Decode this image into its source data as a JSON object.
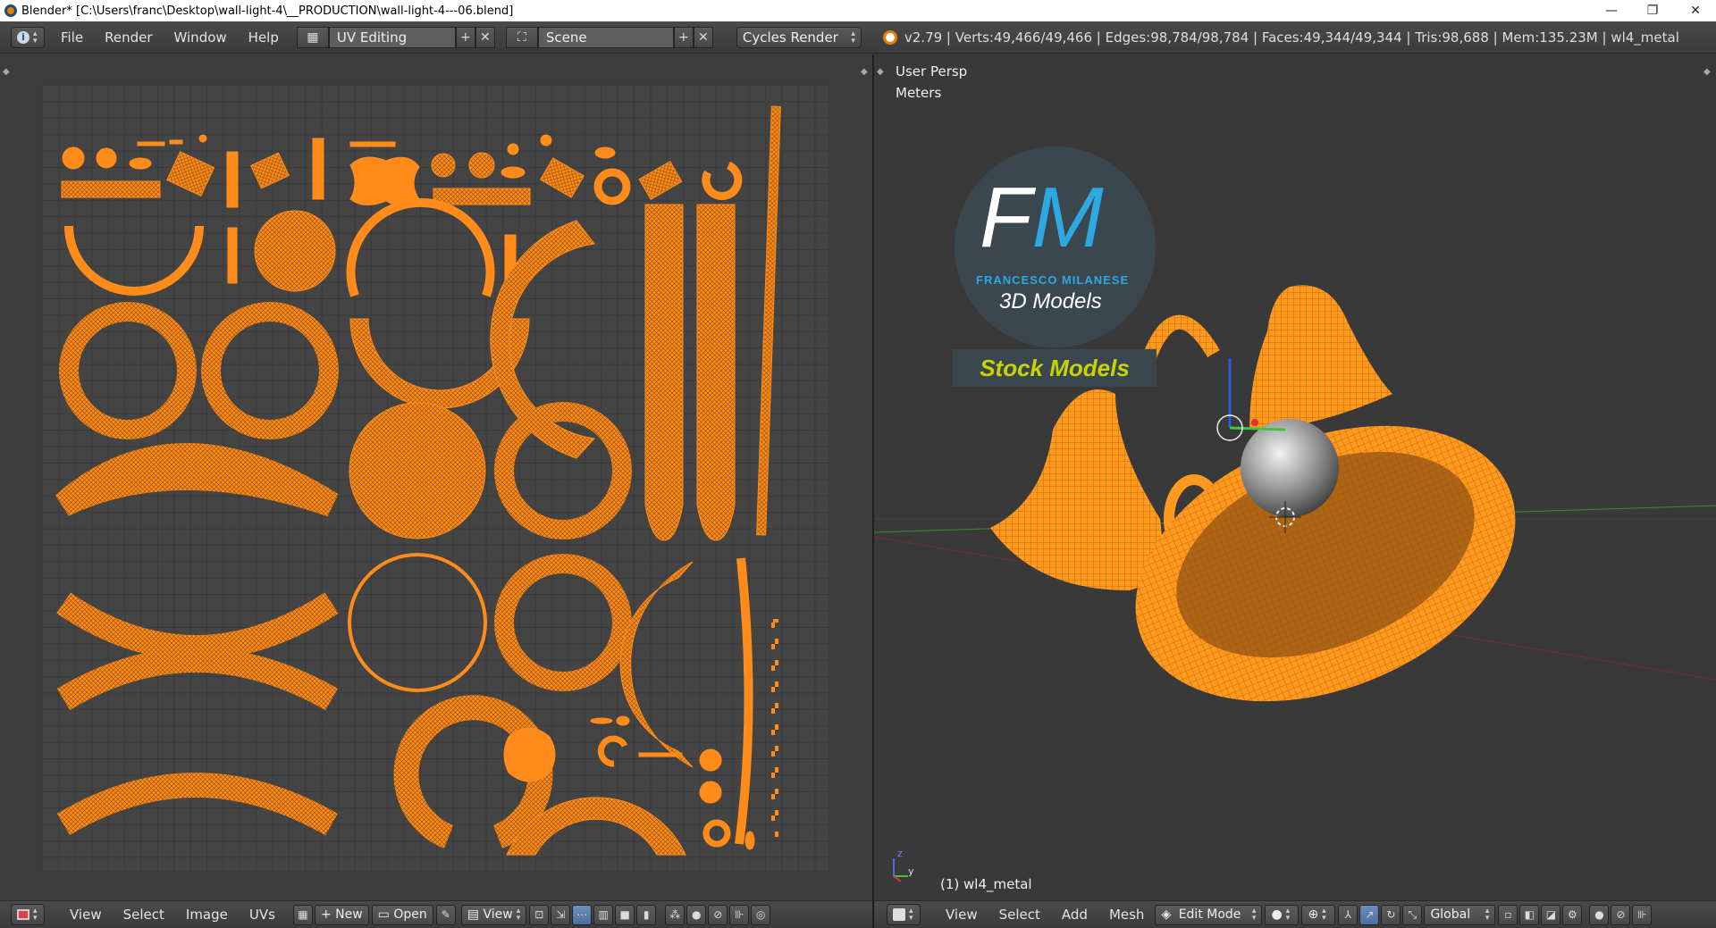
{
  "window": {
    "title": "Blender* [C:\\Users\\franc\\Desktop\\wall-light-4\\__PRODUCTION\\wall-light-4---06.blend]",
    "controls": [
      "—",
      "❐",
      "✕"
    ]
  },
  "info_header": {
    "menus": [
      "File",
      "Render",
      "Window",
      "Help"
    ],
    "screen_layout": "UV Editing",
    "scene": "Scene",
    "render_engine": "Cycles Render",
    "stats": "v2.79 | Verts:49,466/49,466 | Edges:98,784/98,784 | Faces:49,344/49,344 | Tris:98,688 | Mem:135.23M | wl4_metal"
  },
  "uv_editor": {
    "header_menus": [
      "View",
      "Select",
      "Image",
      "UVs"
    ],
    "new_label": "New",
    "open_label": "Open",
    "view_label": "View"
  },
  "viewport": {
    "view_name": "User Persp",
    "units": "Meters",
    "object_label": "(1) wl4_metal",
    "header_menus": [
      "View",
      "Select",
      "Add",
      "Mesh"
    ],
    "mode": "Edit Mode",
    "orientation": "Global",
    "watermark": {
      "initials_f": "F",
      "initials_m": "M",
      "name": "FRANCESCO MILANESE",
      "subtitle": "3D Models",
      "banner": "Stock Models"
    },
    "axis_labels": {
      "z": "z",
      "y": "y"
    }
  },
  "colors": {
    "uv_orange": "#ff8c1a",
    "wire_orange": "#ffa733",
    "watermark_blue": "#2ea8e0",
    "banner_text": "#c8d400"
  },
  "icons": {
    "info": "info-icon",
    "layout": "screen-layout-icon",
    "scene": "scene-icon",
    "blender": "blender-logo-icon"
  }
}
